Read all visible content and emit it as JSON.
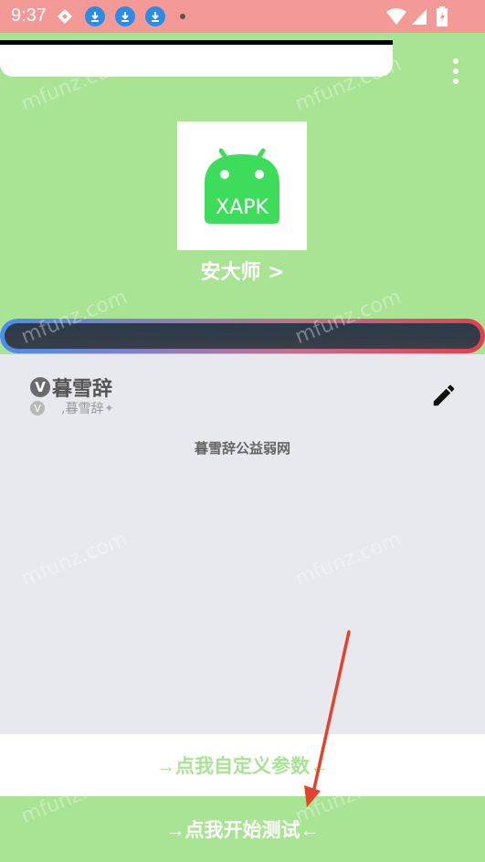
{
  "status_bar": {
    "time": "9:37",
    "icons": [
      "diamond-icon",
      "download-icon",
      "download-icon",
      "download-icon",
      "dot-icon",
      "wifi-icon",
      "signal-icon",
      "battery-icon"
    ]
  },
  "app": {
    "icon_label": "XAPK",
    "name": "安大师 >"
  },
  "profile": {
    "badge": "V",
    "name": "暮雪辞",
    "sub_badge": "V",
    "sub_name": ",暮雪辞"
  },
  "main": {
    "center_text": "暮雪辞公益弱网"
  },
  "buttons": {
    "custom_params": "→点我自定义参数←",
    "start_test": "→点我开始测试←"
  },
  "watermark": "mfunz.com",
  "colors": {
    "background": "#a8e494",
    "status_bar": "#f49a96",
    "android_green": "#3ddc5a",
    "content_bg": "#e8e8ef",
    "arrow": "#e0442c"
  }
}
